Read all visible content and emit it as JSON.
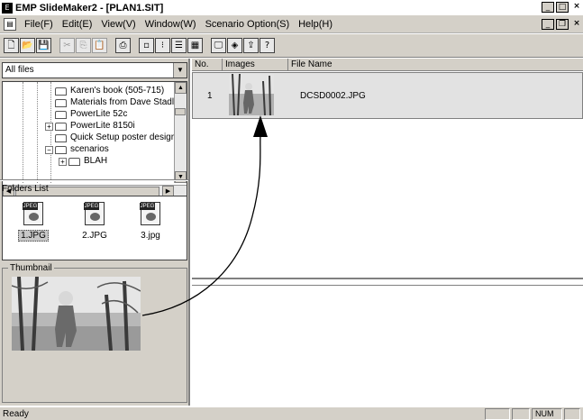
{
  "window": {
    "title": "EMP SlideMaker2 - [PLAN1.SIT]",
    "app_icon": "emp-app-icon"
  },
  "window_buttons": [
    "_",
    "□",
    "×"
  ],
  "mdi_buttons": [
    "_",
    "❐",
    "×"
  ],
  "menu": [
    {
      "label": "File(F)"
    },
    {
      "label": "Edit(E)"
    },
    {
      "label": "View(V)"
    },
    {
      "label": "Window(W)"
    },
    {
      "label": "Scenario Option(S)"
    },
    {
      "label": "Help(H)"
    }
  ],
  "toolbar": [
    {
      "name": "new-icon",
      "glyph": "🗋",
      "disabled": false
    },
    {
      "name": "open-icon",
      "glyph": "📂",
      "disabled": false
    },
    {
      "name": "save-icon",
      "glyph": "💾",
      "disabled": false
    },
    {
      "name": "cut-icon",
      "glyph": "✂",
      "disabled": true
    },
    {
      "name": "copy-icon",
      "glyph": "⎘",
      "disabled": true
    },
    {
      "name": "paste-icon",
      "glyph": "📋",
      "disabled": true
    },
    {
      "name": "print-icon",
      "glyph": "⎙",
      "disabled": false
    },
    {
      "name": "large-icons-icon",
      "glyph": "▫",
      "disabled": false
    },
    {
      "name": "small-icons-icon",
      "glyph": "⁝",
      "disabled": false
    },
    {
      "name": "list-view-icon",
      "glyph": "☰",
      "disabled": false
    },
    {
      "name": "details-view-icon",
      "glyph": "▦",
      "disabled": false
    },
    {
      "name": "monitor-icon",
      "glyph": "🖵",
      "disabled": false
    },
    {
      "name": "send-icon",
      "glyph": "◈",
      "disabled": false
    },
    {
      "name": "transfer-icon",
      "glyph": "⇪",
      "disabled": false
    },
    {
      "name": "help-icon",
      "glyph": "?",
      "disabled": false
    }
  ],
  "left": {
    "filter": "All files",
    "tree": [
      {
        "label": "Karen's book (505-715)",
        "expander": ""
      },
      {
        "label": "Materials from Dave Stadl",
        "expander": ""
      },
      {
        "label": "PowerLite 52c",
        "expander": ""
      },
      {
        "label": "PowerLite 8150i",
        "expander": "+"
      },
      {
        "label": "Quick Setup poster desigr",
        "expander": ""
      },
      {
        "label": "scenarios",
        "expander": "−"
      },
      {
        "label": "BLAH",
        "expander": "+"
      }
    ],
    "folders_list_label": "Folders List",
    "files": [
      {
        "name": "1.JPG",
        "selected": true,
        "badge": "JPEG"
      },
      {
        "name": "2.JPG",
        "selected": false,
        "badge": "JPEG"
      },
      {
        "name": "3.jpg",
        "selected": false,
        "badge": "JPEG"
      }
    ],
    "thumbnail_label": "Thumbnail"
  },
  "list": {
    "columns": [
      "No.",
      "Images",
      "File Name"
    ],
    "rows": [
      {
        "no": "1",
        "file_name": "DCSD0002.JPG"
      }
    ]
  },
  "status": {
    "text": "Ready",
    "panels": [
      "",
      "",
      "NUM",
      ""
    ]
  }
}
